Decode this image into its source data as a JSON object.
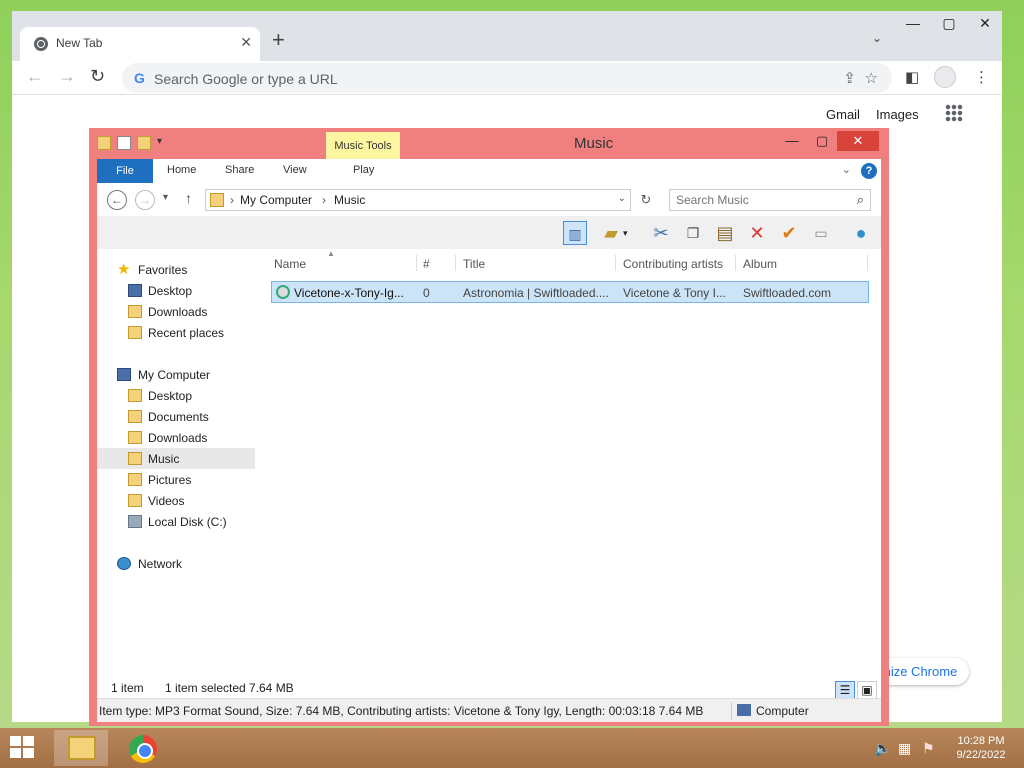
{
  "chrome": {
    "tab_title": "New Tab",
    "omnibox_placeholder": "Search Google or type a URL",
    "gmail": "Gmail",
    "images": "Images",
    "customize": "Customize Chrome",
    "customize_visible": "mize Chrome"
  },
  "explorer": {
    "window_title": "Music",
    "contextual_tab_group": "Music Tools",
    "ribbon_tabs": [
      "File",
      "Home",
      "Share",
      "View",
      "Play"
    ],
    "breadcrumb": [
      "My Computer",
      "Music"
    ],
    "search_placeholder": "Search Music",
    "nav": {
      "favorites": "Favorites",
      "fav_items": [
        "Desktop",
        "Downloads",
        "Recent places"
      ],
      "computer": "My Computer",
      "computer_items": [
        "Desktop",
        "Documents",
        "Downloads",
        "Music",
        "Pictures",
        "Videos",
        "Local Disk (C:)"
      ],
      "network": "Network",
      "selected": "Music"
    },
    "columns": [
      "Name",
      "#",
      "Title",
      "Contributing artists",
      "Album"
    ],
    "rows": [
      {
        "name": "Vicetone-x-Tony-Ig...",
        "number": "0",
        "title": "Astronomia | Swiftloaded....",
        "artists": "Vicetone & Tony I...",
        "album": "Swiftloaded.com"
      }
    ],
    "status": {
      "item_count": "1 item",
      "selected": "1 item selected",
      "size": "7.64 MB",
      "details": "Item type: MP3 Format Sound, Size: 7.64 MB, Contributing artists: Vicetone & Tony Igy, Length: 00:03:18  7.64 MB",
      "location": "Computer"
    }
  },
  "taskbar": {
    "time": "10:28 PM",
    "date": "9/22/2022"
  }
}
